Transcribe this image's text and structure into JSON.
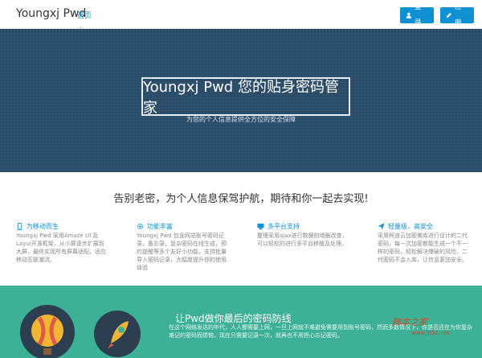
{
  "nav": {
    "brand": "Youngxj Pwd",
    "home": "首页",
    "login": "登录",
    "register": "注册"
  },
  "hero": {
    "title": "Youngxj Pwd 您的贴身密码管家",
    "subtitle": "为您的个人信息提供全方位的安全保障"
  },
  "slogan": "告别老密，为个人信息保驾护航，期待和你一起去实现!",
  "features": [
    {
      "title": "为移动而生",
      "text": "Youngxj Pwd 采用Amaze UI 及 Layui开源框架，从小屏逐步扩展到大屏，最终实现所有屏幕适配，适应移动互联潮流。",
      "icon": "mobile-icon"
    },
    {
      "title": "功能丰富",
      "text": "Youngxj Pwd 包含网站账号密码记录，备忘录，复杂密码在线生成，预约提醒等多个友好小功能，支持批量导入密码记录，大幅度提升你的使用体验",
      "icon": "gear-icon"
    },
    {
      "title": "多平台支持",
      "text": "整理采用ajax进行数据的增删改查，可以轻松的进行多平台移植及处理。",
      "icon": "desktop-icon"
    },
    {
      "title": "轻量级，高安全",
      "text": "采用柯道云加密美库进行设计的二代密码，每一次加密都能生成一个不一样的密码，轻松解决爆破的风险，二代密码不会入库，让信息更加安全。",
      "icon": "send-icon"
    }
  ],
  "bottom": {
    "title": "让Pwd做你最后的密码防线",
    "text": "在这个网络发达的年代，人人都需要上网，一旦上网就不难避免需要用到账号密码，然而多数情况下，你是否还在为你复杂难记的密码而烦恼，现在只需要记录一次，就再也不用担心忘记密码。"
  },
  "watermark": {
    "text": "脚本之家",
    "url": "www.jb51.net"
  },
  "colors": {
    "accent": "#0e90d2",
    "hero_bg": "#2a4c68",
    "bottom_bg": "#3db196"
  }
}
